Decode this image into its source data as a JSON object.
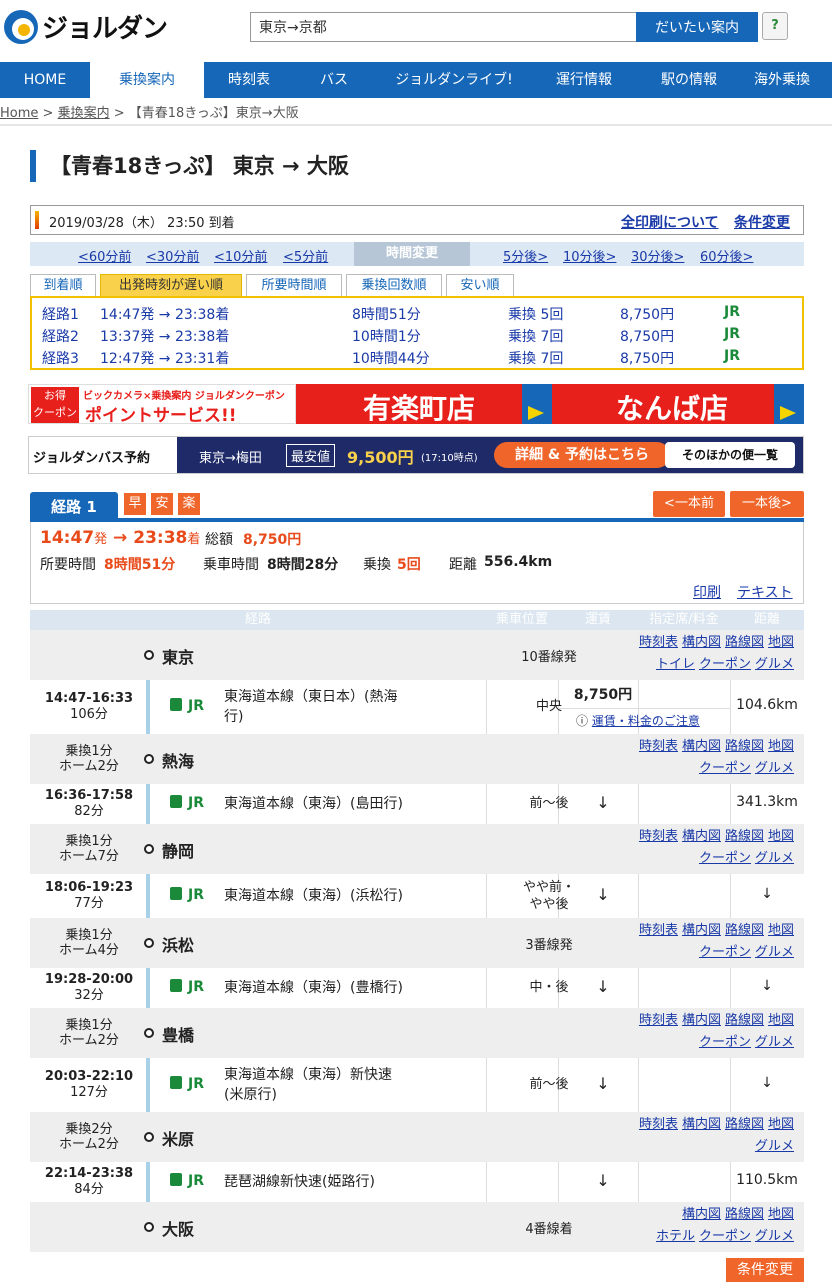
{
  "header": {
    "logo": "ジョルダン",
    "search_value": "東京→京都",
    "search_button": "だいたい案内",
    "help": "?"
  },
  "nav": [
    {
      "label": "HOME",
      "active": false
    },
    {
      "label": "乗換案内",
      "active": true
    },
    {
      "label": "時刻表",
      "active": false
    },
    {
      "label": "バス",
      "active": false
    },
    {
      "label": "ジョルダンライブ!",
      "active": false
    },
    {
      "label": "運行情報",
      "active": false
    },
    {
      "label": "駅の情報",
      "active": false
    },
    {
      "label": "海外乗換",
      "active": false
    }
  ],
  "breadcrumb": {
    "home": "Home",
    "sep": ">",
    "transit": "乗換案内",
    "current": "【青春18きっぷ】東京→大阪"
  },
  "title": "【青春18きっぷ】 東京 → 大阪",
  "date": {
    "text": "2019/03/28（木） 23:50 到着",
    "print": "全印刷について",
    "cond": "条件変更"
  },
  "shift": {
    "minus": [
      "<60分前",
      "<30分前",
      "<10分前",
      "<5分前"
    ],
    "center": "時間変更",
    "plus": [
      "5分後>",
      "10分後>",
      "30分後>",
      "60分後>"
    ]
  },
  "sort_tabs": [
    "到着順",
    "出発時刻が遅い順",
    "所要時間順",
    "乗換回数順",
    "安い順"
  ],
  "routes": [
    {
      "name": "経路1",
      "time": "14:47発 → 23:38着",
      "dur": "8時間51分",
      "transfer": "乗換 5回",
      "fare": "8,750円",
      "company": "JR"
    },
    {
      "name": "経路2",
      "time": "13:37発 → 23:38着",
      "dur": "10時間1分",
      "transfer": "乗換 7回",
      "fare": "8,750円",
      "company": "JR"
    },
    {
      "name": "経路3",
      "time": "12:47発 → 23:31着",
      "dur": "10時間44分",
      "transfer": "乗換 7回",
      "fare": "8,750円",
      "company": "JR"
    }
  ],
  "banner1": {
    "deal": "お得",
    "coupon": "クーポン",
    "brand": "ビックカメラ×乗換案内 ジョルダンクーポン",
    "point": "ポイントサービス!!",
    "store1": "有楽町店",
    "store2": "なんば店"
  },
  "banner2": {
    "logo": "ジョルダンバス予約",
    "route": "東京→梅田",
    "cheapest": "最安値",
    "price": "9,500円",
    "time": "(17:10時点)",
    "detail": "詳細 & 予約はこちら",
    "other": "そのほかの便一覧"
  },
  "route_detail": {
    "tab": "経路 1",
    "badges": [
      "早",
      "安",
      "楽"
    ],
    "prev": "<一本前",
    "next": "一本後>",
    "dep": "14:47",
    "dep_suffix": "発",
    "arrow": " → ",
    "arr": "23:38",
    "arr_suffix": "着",
    "total_label": "総額",
    "total": "8,750円",
    "req_label": "所要時間",
    "req": "8時間51分",
    "ride_label": "乗車時間",
    "ride": "8時間28分",
    "trans_label": "乗換",
    "trans": "5回",
    "dist_label": "距離",
    "dist": "556.4km",
    "print": "印刷",
    "text": "テキスト"
  },
  "table_head": [
    "経路",
    "乗車位置",
    "運賃",
    "指定席/料金",
    "距離"
  ],
  "stations": [
    {
      "name": "東京",
      "transfer": [
        "",
        ""
      ],
      "info": "10番線発",
      "links": [
        [
          "時刻表",
          "構内図",
          "路線図",
          "地図"
        ],
        [
          "トイレ",
          "クーポン",
          "グルメ"
        ]
      ]
    },
    {
      "name": "熱海",
      "transfer": [
        "乗換1分",
        "ホーム2分"
      ],
      "info": "",
      "links": [
        [
          "時刻表",
          "構内図",
          "路線図",
          "地図"
        ],
        [
          "クーポン",
          "グルメ"
        ]
      ]
    },
    {
      "name": "静岡",
      "transfer": [
        "乗換1分",
        "ホーム7分"
      ],
      "info": "",
      "links": [
        [
          "時刻表",
          "構内図",
          "路線図",
          "地図"
        ],
        [
          "クーポン",
          "グルメ"
        ]
      ]
    },
    {
      "name": "浜松",
      "transfer": [
        "乗換1分",
        "ホーム4分"
      ],
      "info": "3番線発",
      "links": [
        [
          "時刻表",
          "構内図",
          "路線図",
          "地図"
        ],
        [
          "クーポン",
          "グルメ"
        ]
      ]
    },
    {
      "name": "豊橋",
      "transfer": [
        "乗換1分",
        "ホーム2分"
      ],
      "info": "",
      "links": [
        [
          "時刻表",
          "構内図",
          "路線図",
          "地図"
        ],
        [
          "クーポン",
          "グルメ"
        ]
      ]
    },
    {
      "name": "米原",
      "transfer": [
        "乗換2分",
        "ホーム2分"
      ],
      "info": "",
      "links": [
        [
          "時刻表",
          "構内図",
          "路線図",
          "地図"
        ],
        [
          "グルメ"
        ]
      ]
    },
    {
      "name": "大阪",
      "transfer": [
        "",
        ""
      ],
      "info": "4番線着",
      "links": [
        [
          "構内図",
          "路線図",
          "地図"
        ],
        [
          "ホテル",
          "クーポン",
          "グルメ"
        ]
      ]
    }
  ],
  "segments": [
    {
      "time": "14:47-16:33",
      "dur": "106分",
      "company": "JR",
      "line": [
        "東海道本線（東日本）(熱海",
        "行)"
      ],
      "pos": [
        "中央",
        ""
      ],
      "fare": "8,750円",
      "fare_note": "運賃・料金のご注意",
      "dist": "104.6km"
    },
    {
      "time": "16:36-17:58",
      "dur": "82分",
      "company": "JR",
      "line": [
        "東海道本線（東海）(島田行)",
        ""
      ],
      "pos": [
        "前～後",
        ""
      ],
      "fare": "↓",
      "fare_note": "",
      "dist": "341.3km"
    },
    {
      "time": "18:06-19:23",
      "dur": "77分",
      "company": "JR",
      "line": [
        "東海道本線（東海）(浜松行)",
        ""
      ],
      "pos": [
        "やや前・",
        "やや後"
      ],
      "fare": "↓",
      "fare_note": "",
      "dist": "↓"
    },
    {
      "time": "19:28-20:00",
      "dur": "32分",
      "company": "JR",
      "line": [
        "東海道本線（東海）(豊橋行)",
        ""
      ],
      "pos": [
        "中・後",
        ""
      ],
      "fare": "↓",
      "fare_note": "",
      "dist": "↓"
    },
    {
      "time": "20:03-22:10",
      "dur": "127分",
      "company": "JR",
      "line": [
        "東海道本線（東海）新快速",
        "(米原行)"
      ],
      "pos": [
        "前～後",
        ""
      ],
      "fare": "↓",
      "fare_note": "",
      "dist": "↓"
    },
    {
      "time": "22:14-23:38",
      "dur": "84分",
      "company": "JR",
      "line": [
        "琵琶湖線新快速(姫路行)",
        ""
      ],
      "pos": [
        "",
        ""
      ],
      "fare": "↓",
      "fare_note": "",
      "dist": "110.5km"
    }
  ],
  "cond_button": "条件変更"
}
